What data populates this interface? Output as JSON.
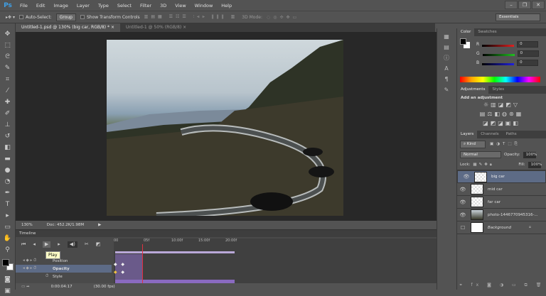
{
  "app": {
    "logo": "Ps",
    "menu": [
      "File",
      "Edit",
      "Image",
      "Layer",
      "Type",
      "Select",
      "Filter",
      "3D",
      "View",
      "Window",
      "Help"
    ],
    "win": [
      "–",
      "❐",
      "✕"
    ]
  },
  "options": {
    "auto_select": "Auto-Select:",
    "group": "Group",
    "show_transform": "Show Transform Controls",
    "mode3d": "3D Mode:",
    "workspace": "Essentials"
  },
  "tabs": [
    {
      "label": "Untitled-1.psd @ 130% (big car, RGB/8) *",
      "close": "×"
    },
    {
      "label": "Untitled-1 @ 50% (RGB/8)",
      "close": "×"
    }
  ],
  "status": {
    "zoom": "130%",
    "doc": "Doc: 452.2K/1.98M",
    "arrow": "▶"
  },
  "color_panel": {
    "tabs": [
      "Color",
      "Swatches"
    ],
    "channels": [
      {
        "label": "R",
        "value": "0",
        "color": "#e02020"
      },
      {
        "label": "G",
        "value": "0",
        "color": "#20c020"
      },
      {
        "label": "B",
        "value": "0",
        "color": "#2020e0"
      }
    ]
  },
  "adjustments": {
    "tabs": [
      "Adjustments",
      "Styles"
    ],
    "title": "Add an adjustment"
  },
  "layers_panel": {
    "tabs": [
      "Layers",
      "Channels",
      "Paths"
    ],
    "kind": "Kind",
    "blend": "Normal",
    "opacity_label": "Opacity:",
    "opacity": "100%",
    "lock_label": "Lock:",
    "fill_label": "Fill:",
    "fill": "100%",
    "layers": [
      {
        "name": "big car",
        "selected": true
      },
      {
        "name": "mid car"
      },
      {
        "name": "far car"
      },
      {
        "name": "photo-1446770945316-..."
      },
      {
        "name": "Background",
        "locked": true
      }
    ]
  },
  "timeline": {
    "title": "Timeline",
    "tooltip": "Play",
    "ticks": [
      "00",
      "05f",
      "10:00f",
      "15:00f",
      "20:00f"
    ],
    "props": [
      "Position",
      "Opacity",
      "Style"
    ],
    "time": "0:00:04:17",
    "fps": "(30.00 fps)"
  }
}
